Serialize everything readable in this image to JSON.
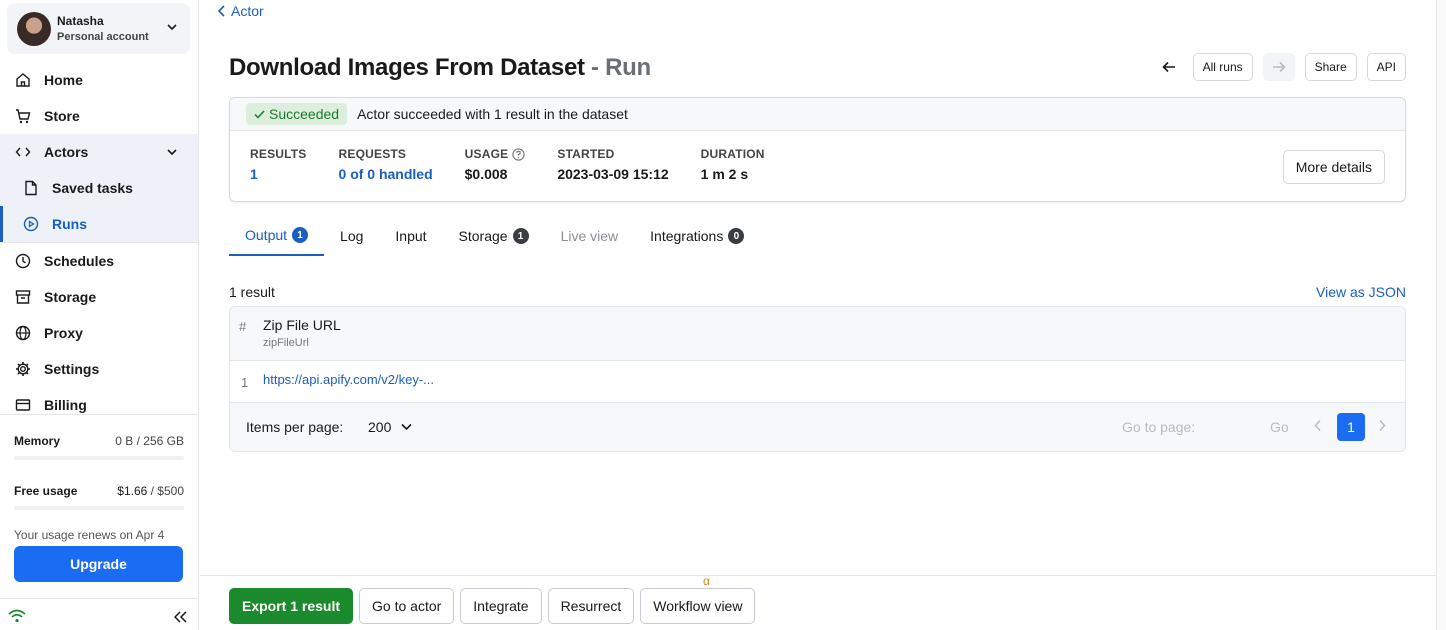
{
  "account": {
    "name": "Natasha",
    "type": "Personal account"
  },
  "nav": {
    "home": "Home",
    "store": "Store",
    "actors": "Actors",
    "saved_tasks": "Saved tasks",
    "runs": "Runs",
    "schedules": "Schedules",
    "storage": "Storage",
    "proxy": "Proxy",
    "settings": "Settings",
    "billing": "Billing"
  },
  "usage": {
    "memory_label": "Memory",
    "memory_value": "0 B / 256 GB",
    "memory_fraction": 0,
    "free_label": "Free usage",
    "free_value": "$1.66",
    "free_limit": " / $500",
    "free_fraction": 0.0033,
    "renew_note": "Your usage renews on Apr 4",
    "upgrade": "Upgrade"
  },
  "breadcrumb": {
    "back": "Actor"
  },
  "header": {
    "title": "Download Images From Dataset",
    "title_suffix": " - Run",
    "all_runs": "All runs",
    "share": "Share",
    "api": "API"
  },
  "run": {
    "status": "Succeeded",
    "message": "Actor succeeded with 1 result in the dataset",
    "stats": {
      "results_label": "RESULTS",
      "results_value": "1",
      "requests_label": "REQUESTS",
      "requests_value": "0 of 0 handled",
      "usage_label": "USAGE",
      "usage_value": "$0.008",
      "started_label": "STARTED",
      "started_value": "2023-03-09 15:12",
      "duration_label": "DURATION",
      "duration_value": "1 m 2 s"
    },
    "more_details": "More details"
  },
  "tabs": {
    "output": "Output",
    "output_count": "1",
    "log": "Log",
    "input": "Input",
    "storage": "Storage",
    "storage_count": "1",
    "live_view": "Live view",
    "integrations": "Integrations",
    "integrations_count": "0"
  },
  "results": {
    "count_text": "1 result",
    "view_json": "View as JSON",
    "hash": "#",
    "column_title": "Zip File URL",
    "column_key": "zipFileUrl",
    "rows": [
      {
        "num": "1",
        "url": "https://api.apify.com/v2/key-..."
      }
    ],
    "items_per_page_label": "Items per page:",
    "items_per_page_value": "200",
    "go_to_page": "Go to page:",
    "go": "Go",
    "current_page": "1"
  },
  "footer": {
    "export": "Export 1 result",
    "go_to_actor": "Go to actor",
    "integrate": "Integrate",
    "resurrect": "Resurrect",
    "workflow_view": "Workflow view",
    "alpha": "α"
  },
  "colors": {
    "accent": "#1a5fbf",
    "primary_button": "#1b6cf2",
    "success": "#1a8a2c"
  }
}
